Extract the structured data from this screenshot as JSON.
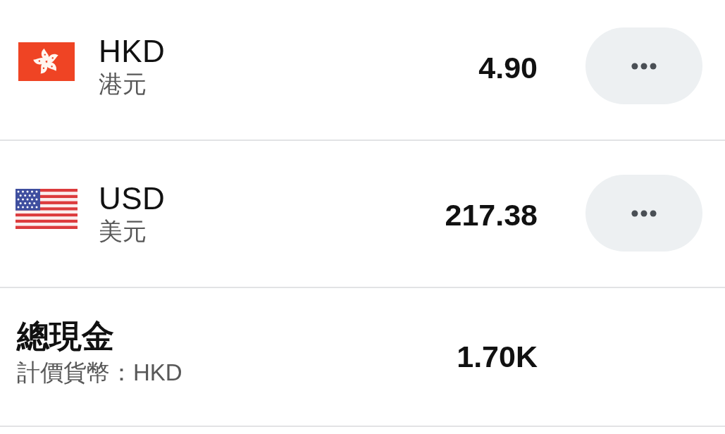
{
  "currencies": [
    {
      "kind": "hongkong",
      "code": "HKD",
      "name": "港元",
      "amount": "4.90"
    },
    {
      "kind": "usa",
      "code": "USD",
      "name": "美元",
      "amount": "217.38"
    }
  ],
  "total": {
    "title": "總現金",
    "subtitle": "計價貨幣：HKD",
    "amount": "1.70K"
  }
}
